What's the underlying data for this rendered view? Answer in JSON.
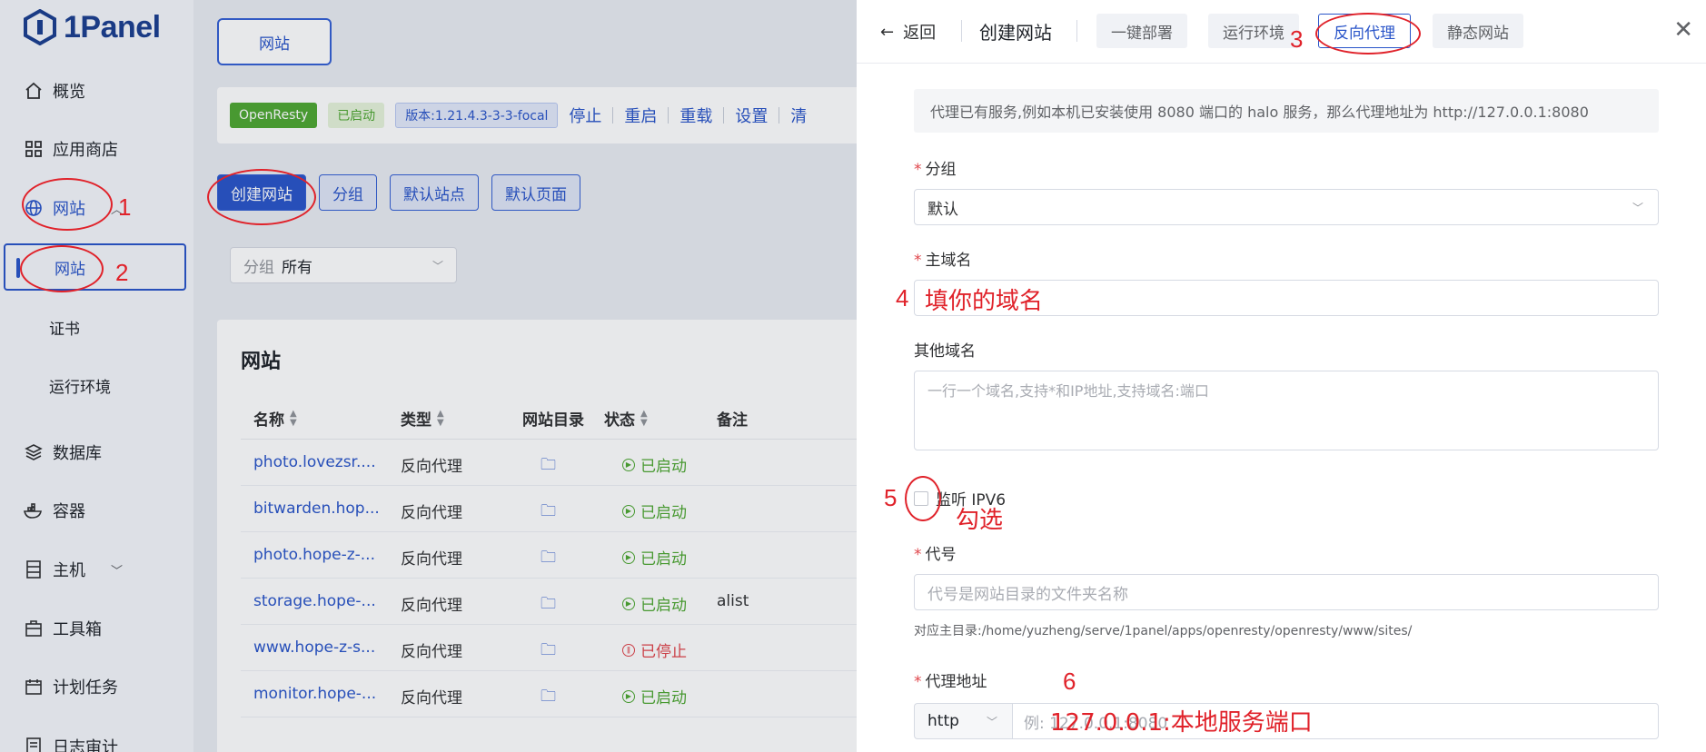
{
  "brand": {
    "name": "1Panel"
  },
  "sidebar": {
    "items": [
      {
        "label": "概览",
        "icon": "home-icon"
      },
      {
        "label": "应用商店",
        "icon": "grid-icon"
      },
      {
        "label": "网站",
        "icon": "globe-icon"
      },
      {
        "label": "数据库",
        "icon": "layers-icon"
      },
      {
        "label": "容器",
        "icon": "container-icon"
      },
      {
        "label": "主机",
        "icon": "server-icon"
      },
      {
        "label": "工具箱",
        "icon": "toolbox-icon"
      },
      {
        "label": "计划任务",
        "icon": "calendar-icon"
      },
      {
        "label": "日志审计",
        "icon": "log-icon"
      }
    ],
    "website_sub": [
      "网站",
      "证书",
      "运行环境"
    ]
  },
  "main": {
    "top_tab": "网站",
    "status_bar": {
      "app": "OpenResty",
      "state": "已启动",
      "version": "版本:1.21.4.3-3-3-focal",
      "actions": [
        "停止",
        "重启",
        "重载",
        "设置",
        "清"
      ]
    },
    "buttons": [
      "创建网站",
      "分组",
      "默认站点",
      "默认页面"
    ],
    "filter": {
      "label": "分组",
      "value": "所有"
    },
    "table": {
      "title": "网站",
      "headers": [
        "名称",
        "类型",
        "网站目录",
        "状态",
        "备注"
      ],
      "rows": [
        {
          "name": "photo.lovezsr....",
          "type": "反向代理",
          "status": "已启动",
          "note": ""
        },
        {
          "name": "bitwarden.hop...",
          "type": "反向代理",
          "status": "已启动",
          "note": ""
        },
        {
          "name": "photo.hope-z-...",
          "type": "反向代理",
          "status": "已启动",
          "note": ""
        },
        {
          "name": "storage.hope-...",
          "type": "反向代理",
          "status": "已启动",
          "note": "alist"
        },
        {
          "name": "www.hope-z-s...",
          "type": "反向代理",
          "status": "已停止",
          "note": ""
        },
        {
          "name": "monitor.hope-...",
          "type": "反向代理",
          "status": "已启动",
          "note": ""
        }
      ]
    }
  },
  "drawer": {
    "back": "返回",
    "title": "创建网站",
    "tabs": [
      "一键部署",
      "运行环境",
      "反向代理",
      "静态网站"
    ],
    "tip": "代理已有服务,例如本机已安装使用 8080 端口的 halo 服务，那么代理地址为 http://127.0.0.1:8080",
    "group": {
      "label": "分组",
      "value": "默认"
    },
    "primary_domain": {
      "label": "主域名"
    },
    "other_domains": {
      "label": "其他域名",
      "placeholder": "一行一个域名,支持*和IP地址,支持域名:端口"
    },
    "ipv6": {
      "label": "监听 IPV6"
    },
    "alias": {
      "label": "代号",
      "placeholder": "代号是网站目录的文件夹名称",
      "hint": "对应主目录:/home/yuzheng/serve/1panel/apps/openresty/openresty/www/sites/"
    },
    "proxy": {
      "label": "代理地址",
      "protocol": "http",
      "placeholder": "例: 127.0.0.1:8080"
    }
  },
  "annotations": {
    "numbers": [
      "1",
      "2",
      "3",
      "4",
      "5",
      "6"
    ],
    "domain_note": "填你的域名",
    "check_note": "勾选",
    "proxy_note": "127.0.0.1:本地服务端口"
  },
  "colors": {
    "accent": "#2a55c9",
    "annotation": "#e0222a",
    "success": "#4ea832",
    "danger": "#e0454b"
  }
}
